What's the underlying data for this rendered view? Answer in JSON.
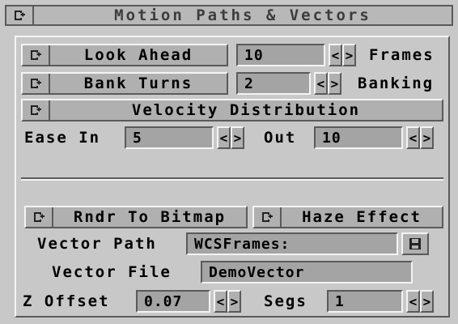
{
  "window": {
    "title": "Motion Paths & Vectors"
  },
  "look_ahead": {
    "button": "Look Ahead",
    "value": "10",
    "unit": "Frames"
  },
  "bank_turns": {
    "button": "Bank Turns",
    "value": "2",
    "unit": "Banking"
  },
  "velocity": {
    "button": "Velocity Distribution"
  },
  "ease": {
    "in_label": "Ease In",
    "in_value": "5",
    "out_label": "Out",
    "out_value": "10"
  },
  "render": {
    "bitmap_button": "Rndr To Bitmap",
    "haze_button": "Haze Effect"
  },
  "vector_path": {
    "label": "Vector Path",
    "value": "WCSFrames:"
  },
  "vector_file": {
    "label": "Vector File",
    "value": "DemoVector"
  },
  "z_offset": {
    "label": "Z Offset",
    "value": "0.07",
    "segs_label": "Segs",
    "segs_value": "1"
  },
  "arrows": {
    "left": "<",
    "right": ">"
  },
  "icons": {
    "cycle": "cycle-gadget-icon",
    "disk": "disk-icon"
  }
}
